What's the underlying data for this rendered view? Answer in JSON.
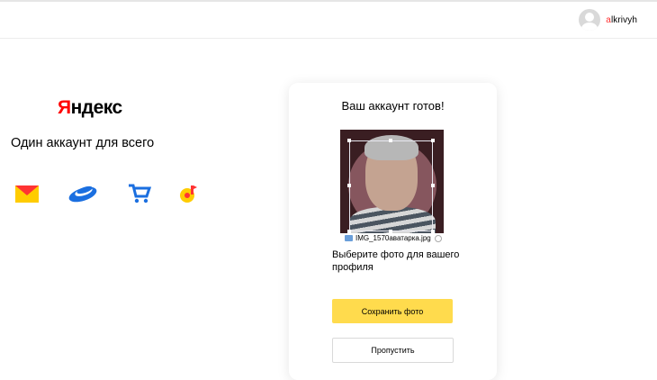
{
  "header": {
    "login_first": "a",
    "login_rest": "lkrivyh"
  },
  "brand": {
    "logo_first": "Я",
    "logo_rest": "ндекс",
    "tagline": "Один аккаунт для всего"
  },
  "services": [
    {
      "name": "mail-icon"
    },
    {
      "name": "disk-icon"
    },
    {
      "name": "market-icon"
    },
    {
      "name": "music-icon"
    }
  ],
  "card": {
    "title": "Ваш аккаунт готов!",
    "filename": "IMG_1570аватарка.jpg",
    "choose_text": "Выберите фото для вашего профиля",
    "save_label": "Сохранить фото",
    "skip_label": "Пропустить"
  },
  "colors": {
    "accent_yellow": "#ffdb4d",
    "brand_red": "#ff0000"
  }
}
